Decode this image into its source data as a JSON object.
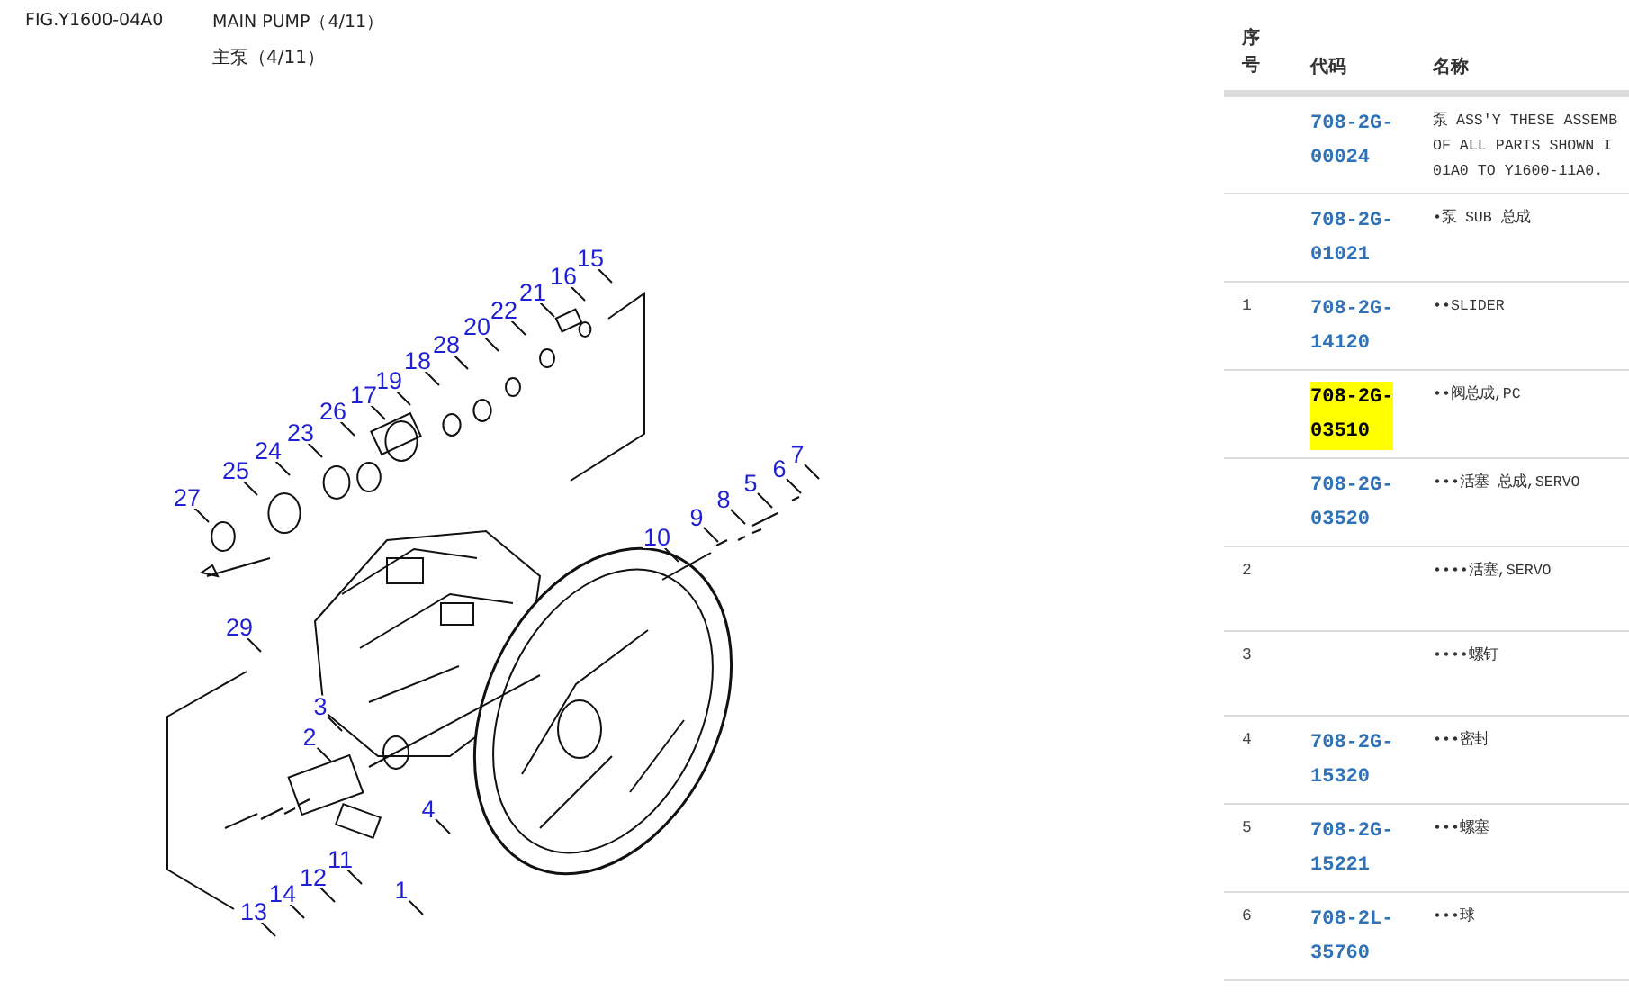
{
  "header": {
    "figure": "FIG.Y1600-04A0",
    "title": "MAIN PUMP（4/11）",
    "subtitle": "主泵（4/11）"
  },
  "diagram": {
    "callouts": [
      "15",
      "16",
      "21",
      "22",
      "20",
      "28",
      "18",
      "19",
      "17",
      "26",
      "23",
      "24",
      "25",
      "27",
      "29",
      "10",
      "9",
      "8",
      "5",
      "6",
      "7",
      "3",
      "2",
      "4",
      "1",
      "11",
      "12",
      "14",
      "13"
    ]
  },
  "table": {
    "columns": [
      "序号",
      "代码",
      "名称"
    ],
    "rows": [
      {
        "no": "",
        "code": "708-2G-\n00024",
        "name": "泵 ASS'Y THESE ASSEMB\nOF ALL PARTS SHOWN I\n01A0 TO Y1600-11A0."
      },
      {
        "no": "",
        "code": "708-2G-\n01021",
        "name": "•泵 SUB 总成"
      },
      {
        "no": "1",
        "code": "708-2G-\n14120",
        "name": "••SLIDER"
      },
      {
        "no": "",
        "code": "708-2G-\n03510",
        "name": "••阀总成,PC",
        "highlighted": true
      },
      {
        "no": "",
        "code": "708-2G-\n03520",
        "name": "•••活塞 总成,SERVO"
      },
      {
        "no": "2",
        "code": "",
        "name": "••••活塞,SERVO"
      },
      {
        "no": "3",
        "code": "",
        "name": "••••螺钉"
      },
      {
        "no": "4",
        "code": "708-2G-\n15320",
        "name": "•••密封"
      },
      {
        "no": "5",
        "code": "708-2G-\n15221",
        "name": "•••螺塞"
      },
      {
        "no": "6",
        "code": "708-2L-\n35760",
        "name": "•••球"
      }
    ]
  }
}
